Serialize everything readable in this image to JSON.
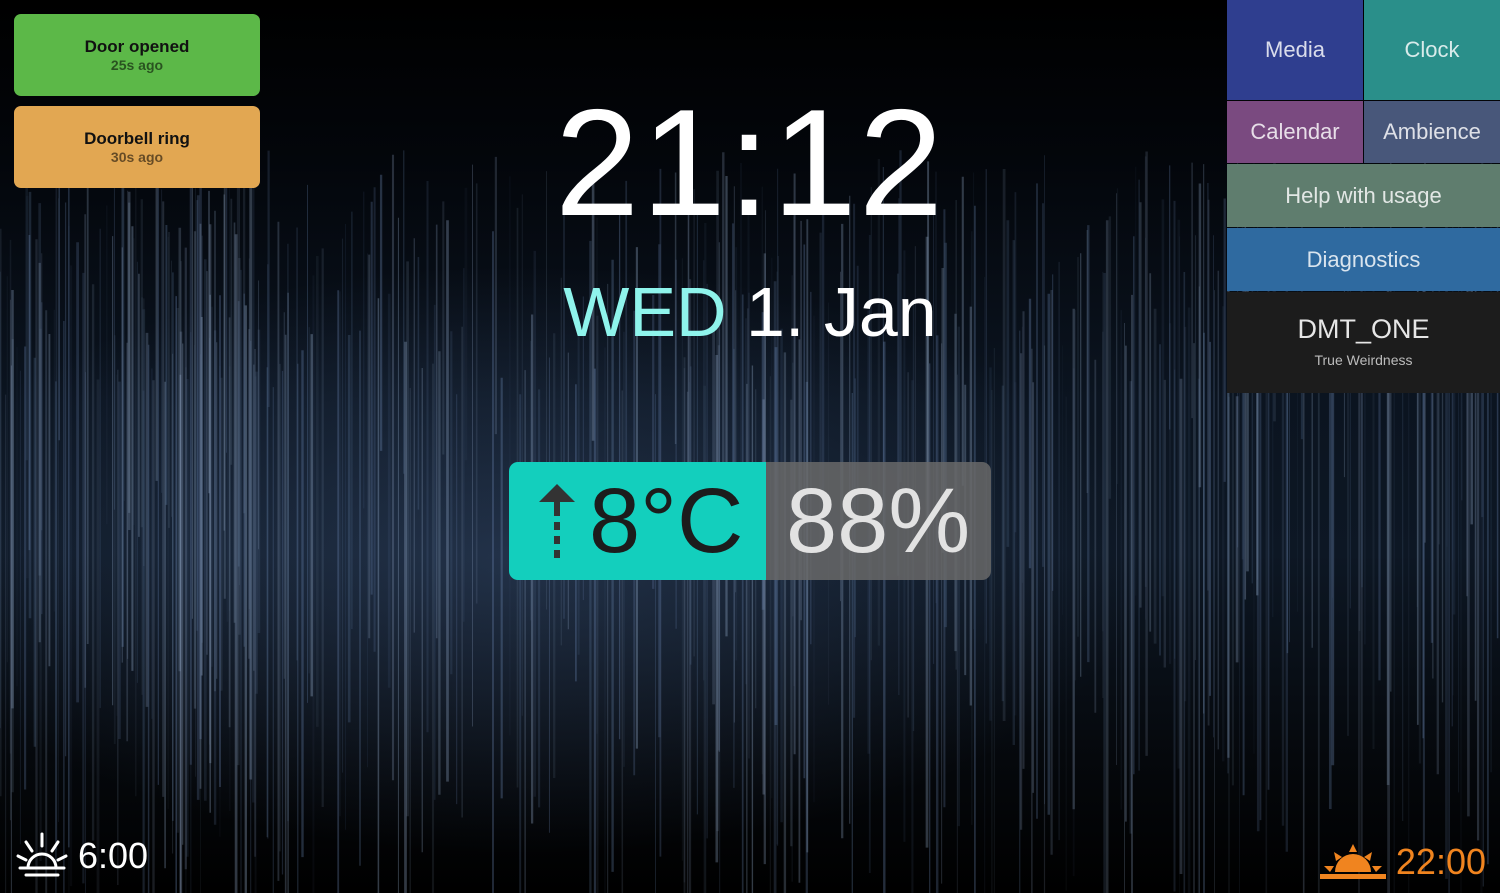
{
  "notifications": [
    {
      "title": "Door opened",
      "time": "25s ago",
      "color": "#5cb848"
    },
    {
      "title": "Doorbell ring",
      "time": "30s ago",
      "color": "#e2a752"
    }
  ],
  "clock": {
    "time": "21:12",
    "weekday": "WED",
    "date": "1. Jan",
    "weekday_color": "#8ff4ec"
  },
  "weather": {
    "temperature": "8°C",
    "humidity": "88%",
    "trend_icon": "arrow-up-dotted-icon",
    "temp_color": "#13cfbd"
  },
  "menu": {
    "media": "Media",
    "clock": "Clock",
    "calendar": "Calendar",
    "ambience": "Ambience",
    "help": "Help with usage",
    "diagnostics": "Diagnostics"
  },
  "device": {
    "name": "DMT_ONE",
    "subtitle": "True Weirdness"
  },
  "sun": {
    "sunrise_time": "6:00",
    "sunrise_icon": "sunrise-icon",
    "sunset_time": "22:00",
    "sunset_icon": "sunset-icon",
    "sunset_color": "#f0841f"
  }
}
